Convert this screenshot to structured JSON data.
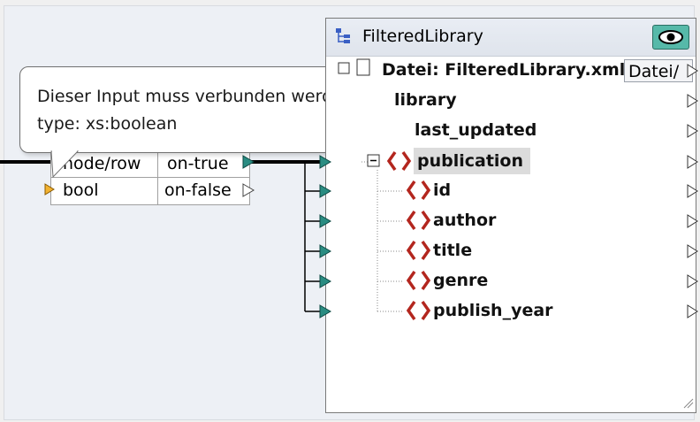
{
  "tooltip": {
    "line1": "Dieser Input muss verbunden werden.",
    "line2": "type: xs:boolean"
  },
  "filter": {
    "input1": "node/row",
    "input2": "bool",
    "output1": "on-true",
    "output2": "on-false"
  },
  "component": {
    "title": "FilteredLibrary",
    "file_row": "Datei: FilteredLibrary.xml",
    "file_button": "Datei/",
    "items": [
      "library",
      "last_updated",
      "publication",
      "id",
      "author",
      "title",
      "genre",
      "publish_year"
    ]
  },
  "colors": {
    "connector": "#2a8c82",
    "warning_connector": "#e0a020",
    "element_icon": "#b3261e",
    "eye_button": "#56b9a9"
  },
  "icons": {
    "component_icon": "tree-structure-icon",
    "eye": "eye-icon",
    "collapse": "minus-box-icon",
    "element": "xml-element-icon"
  }
}
